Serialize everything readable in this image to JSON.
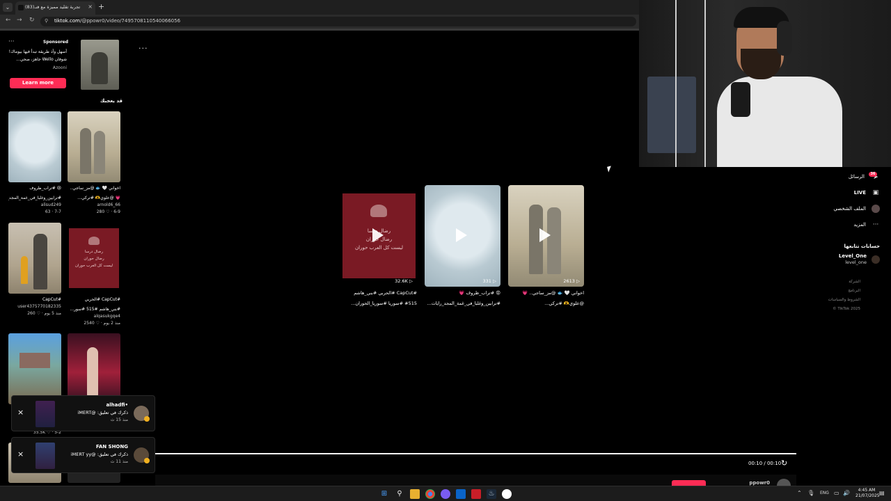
{
  "browser": {
    "tab_title": "تجربة تقليد مميزة مع فنـ(83)",
    "tab_close": "×",
    "new_tab": "+",
    "url_domain": "tiktok.com",
    "url_path": "/@ppowr0/video/7495708110540066056",
    "back": "←",
    "forward": "→",
    "reload": "↻",
    "dropdown": "⌄"
  },
  "sponsored": {
    "menu": "···",
    "label": "Sponsored",
    "text": "أسهل وأذ طريقة تبدأ فيها بيوماك! شوفان Wello جاهز، صحي...",
    "author": "Azooni",
    "cta": "Learn more"
  },
  "feed": {
    "title": "قد يعجبك",
    "cards": [
      {
        "caption": "😢 #تراب_ظروف",
        "caption2": "#ترابين_وغلبا_في_غمة_المجد_رايات...",
        "author": "alisud249",
        "stats": "63 · 7-7"
      },
      {
        "caption": "اخواني 🤍 🐟 @مز_ساجي..",
        "caption2": "💗 @علوي🫶 #تركي...",
        "author": "arnold6_66",
        "stats": "280 ♡ · 6-9"
      },
      {
        "caption": "#CapCut",
        "caption2": "",
        "author": "user4375770182335",
        "stats": "260 ♡ · منذ 5 يوم"
      },
      {
        "caption": "#CapCut #الحربي",
        "caption2": "#بني_هاشم #515 #سور...",
        "author": "alqasukgqe4",
        "stats": "2540 ♡ · منذ 2 يوم"
      },
      {
        "caption": "",
        "caption2": "",
        "author": "",
        "stats": "35.5K ♡ · 5-2"
      },
      {
        "caption": "",
        "caption2": "",
        "author": "",
        "stats": ""
      }
    ],
    "red_text": [
      "رضال درسا",
      "رضال حوران",
      "ليست كل العرب حوران"
    ]
  },
  "toasts": [
    {
      "close": "×",
      "name": "alhadfi•",
      "message": "ذكرك في تعليق: @iMERT",
      "time": "منذ 15 ث"
    },
    {
      "close": "×",
      "name": "FAN SHONG",
      "message": "ذكرك في تعليق: @iMERT yy",
      "time": "منذ 11 ث"
    }
  ],
  "player": {
    "more": "···",
    "videos": [
      {
        "count": "32.6K",
        "caption": "#CapCut #الحربي #بني_هاشم",
        "caption2": "#515 #سوريا #سوريا_الحوران..."
      },
      {
        "count": "331",
        "caption": "😡 #تراب_ظروف 💗",
        "caption2": "#ترابين_وغلبا_في_غمة_المجد_رايات..."
      },
      {
        "count": "2613",
        "caption": "اخواني 🤍 🐟 @مز_ساجي.. 💗",
        "caption2": "@علوي🫶 #تركي..."
      }
    ],
    "red_text": [
      "رضال درسا",
      "رضال حوران",
      "ليست كل العرب حوران"
    ],
    "time": "00:10 / 00:10",
    "replay": "↻",
    "bottom_user": "ppowr0"
  },
  "sidebar": {
    "messages": "الرسائل",
    "messages_badge": "36",
    "live": "LIVE",
    "profile": "الملف الشخصي",
    "more": "المزيد",
    "following_title": "حسابات تتابعها",
    "account_name": "Level_One",
    "account_handle": "level_one",
    "links": [
      "الشركة",
      "البرنامج",
      "الشروط والسياسات",
      "TikTok 2025 ©"
    ]
  },
  "taskbar": {
    "lang": "ENG",
    "time": "4:45 AM",
    "date": "21/07/2025",
    "tray_chevron": "⌃"
  },
  "colors": {
    "accent": "#fe2c55",
    "background": "#000000"
  }
}
